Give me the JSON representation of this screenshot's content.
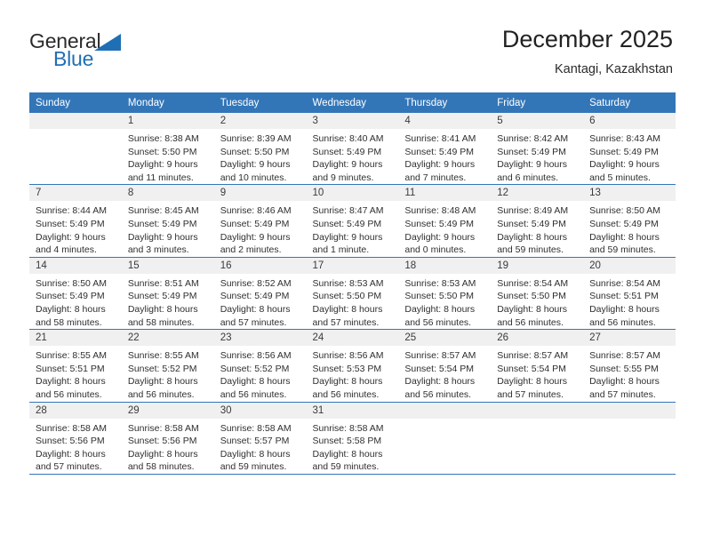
{
  "brand": {
    "name_part1": "General",
    "name_part2": "Blue"
  },
  "header": {
    "title": "December 2025",
    "subtitle": "Kantagi, Kazakhstan"
  },
  "calendar": {
    "weekday_headers": [
      "Sunday",
      "Monday",
      "Tuesday",
      "Wednesday",
      "Thursday",
      "Friday",
      "Saturday"
    ],
    "accent_color": "#3376b8",
    "daynum_band_color": "#f0f0f0",
    "weeks": [
      [
        {
          "day": "",
          "blank": true,
          "sunrise": "",
          "sunset": "",
          "daylight1": "",
          "daylight2": ""
        },
        {
          "day": "1",
          "blank": false,
          "sunrise": "Sunrise: 8:38 AM",
          "sunset": "Sunset: 5:50 PM",
          "daylight1": "Daylight: 9 hours",
          "daylight2": "and 11 minutes."
        },
        {
          "day": "2",
          "blank": false,
          "sunrise": "Sunrise: 8:39 AM",
          "sunset": "Sunset: 5:50 PM",
          "daylight1": "Daylight: 9 hours",
          "daylight2": "and 10 minutes."
        },
        {
          "day": "3",
          "blank": false,
          "sunrise": "Sunrise: 8:40 AM",
          "sunset": "Sunset: 5:49 PM",
          "daylight1": "Daylight: 9 hours",
          "daylight2": "and 9 minutes."
        },
        {
          "day": "4",
          "blank": false,
          "sunrise": "Sunrise: 8:41 AM",
          "sunset": "Sunset: 5:49 PM",
          "daylight1": "Daylight: 9 hours",
          "daylight2": "and 7 minutes."
        },
        {
          "day": "5",
          "blank": false,
          "sunrise": "Sunrise: 8:42 AM",
          "sunset": "Sunset: 5:49 PM",
          "daylight1": "Daylight: 9 hours",
          "daylight2": "and 6 minutes."
        },
        {
          "day": "6",
          "blank": false,
          "sunrise": "Sunrise: 8:43 AM",
          "sunset": "Sunset: 5:49 PM",
          "daylight1": "Daylight: 9 hours",
          "daylight2": "and 5 minutes."
        }
      ],
      [
        {
          "day": "7",
          "blank": false,
          "sunrise": "Sunrise: 8:44 AM",
          "sunset": "Sunset: 5:49 PM",
          "daylight1": "Daylight: 9 hours",
          "daylight2": "and 4 minutes."
        },
        {
          "day": "8",
          "blank": false,
          "sunrise": "Sunrise: 8:45 AM",
          "sunset": "Sunset: 5:49 PM",
          "daylight1": "Daylight: 9 hours",
          "daylight2": "and 3 minutes."
        },
        {
          "day": "9",
          "blank": false,
          "sunrise": "Sunrise: 8:46 AM",
          "sunset": "Sunset: 5:49 PM",
          "daylight1": "Daylight: 9 hours",
          "daylight2": "and 2 minutes."
        },
        {
          "day": "10",
          "blank": false,
          "sunrise": "Sunrise: 8:47 AM",
          "sunset": "Sunset: 5:49 PM",
          "daylight1": "Daylight: 9 hours",
          "daylight2": "and 1 minute."
        },
        {
          "day": "11",
          "blank": false,
          "sunrise": "Sunrise: 8:48 AM",
          "sunset": "Sunset: 5:49 PM",
          "daylight1": "Daylight: 9 hours",
          "daylight2": "and 0 minutes."
        },
        {
          "day": "12",
          "blank": false,
          "sunrise": "Sunrise: 8:49 AM",
          "sunset": "Sunset: 5:49 PM",
          "daylight1": "Daylight: 8 hours",
          "daylight2": "and 59 minutes."
        },
        {
          "day": "13",
          "blank": false,
          "sunrise": "Sunrise: 8:50 AM",
          "sunset": "Sunset: 5:49 PM",
          "daylight1": "Daylight: 8 hours",
          "daylight2": "and 59 minutes."
        }
      ],
      [
        {
          "day": "14",
          "blank": false,
          "sunrise": "Sunrise: 8:50 AM",
          "sunset": "Sunset: 5:49 PM",
          "daylight1": "Daylight: 8 hours",
          "daylight2": "and 58 minutes."
        },
        {
          "day": "15",
          "blank": false,
          "sunrise": "Sunrise: 8:51 AM",
          "sunset": "Sunset: 5:49 PM",
          "daylight1": "Daylight: 8 hours",
          "daylight2": "and 58 minutes."
        },
        {
          "day": "16",
          "blank": false,
          "sunrise": "Sunrise: 8:52 AM",
          "sunset": "Sunset: 5:49 PM",
          "daylight1": "Daylight: 8 hours",
          "daylight2": "and 57 minutes."
        },
        {
          "day": "17",
          "blank": false,
          "sunrise": "Sunrise: 8:53 AM",
          "sunset": "Sunset: 5:50 PM",
          "daylight1": "Daylight: 8 hours",
          "daylight2": "and 57 minutes."
        },
        {
          "day": "18",
          "blank": false,
          "sunrise": "Sunrise: 8:53 AM",
          "sunset": "Sunset: 5:50 PM",
          "daylight1": "Daylight: 8 hours",
          "daylight2": "and 56 minutes."
        },
        {
          "day": "19",
          "blank": false,
          "sunrise": "Sunrise: 8:54 AM",
          "sunset": "Sunset: 5:50 PM",
          "daylight1": "Daylight: 8 hours",
          "daylight2": "and 56 minutes."
        },
        {
          "day": "20",
          "blank": false,
          "sunrise": "Sunrise: 8:54 AM",
          "sunset": "Sunset: 5:51 PM",
          "daylight1": "Daylight: 8 hours",
          "daylight2": "and 56 minutes."
        }
      ],
      [
        {
          "day": "21",
          "blank": false,
          "sunrise": "Sunrise: 8:55 AM",
          "sunset": "Sunset: 5:51 PM",
          "daylight1": "Daylight: 8 hours",
          "daylight2": "and 56 minutes."
        },
        {
          "day": "22",
          "blank": false,
          "sunrise": "Sunrise: 8:55 AM",
          "sunset": "Sunset: 5:52 PM",
          "daylight1": "Daylight: 8 hours",
          "daylight2": "and 56 minutes."
        },
        {
          "day": "23",
          "blank": false,
          "sunrise": "Sunrise: 8:56 AM",
          "sunset": "Sunset: 5:52 PM",
          "daylight1": "Daylight: 8 hours",
          "daylight2": "and 56 minutes."
        },
        {
          "day": "24",
          "blank": false,
          "sunrise": "Sunrise: 8:56 AM",
          "sunset": "Sunset: 5:53 PM",
          "daylight1": "Daylight: 8 hours",
          "daylight2": "and 56 minutes."
        },
        {
          "day": "25",
          "blank": false,
          "sunrise": "Sunrise: 8:57 AM",
          "sunset": "Sunset: 5:54 PM",
          "daylight1": "Daylight: 8 hours",
          "daylight2": "and 56 minutes."
        },
        {
          "day": "26",
          "blank": false,
          "sunrise": "Sunrise: 8:57 AM",
          "sunset": "Sunset: 5:54 PM",
          "daylight1": "Daylight: 8 hours",
          "daylight2": "and 57 minutes."
        },
        {
          "day": "27",
          "blank": false,
          "sunrise": "Sunrise: 8:57 AM",
          "sunset": "Sunset: 5:55 PM",
          "daylight1": "Daylight: 8 hours",
          "daylight2": "and 57 minutes."
        }
      ],
      [
        {
          "day": "28",
          "blank": false,
          "sunrise": "Sunrise: 8:58 AM",
          "sunset": "Sunset: 5:56 PM",
          "daylight1": "Daylight: 8 hours",
          "daylight2": "and 57 minutes."
        },
        {
          "day": "29",
          "blank": false,
          "sunrise": "Sunrise: 8:58 AM",
          "sunset": "Sunset: 5:56 PM",
          "daylight1": "Daylight: 8 hours",
          "daylight2": "and 58 minutes."
        },
        {
          "day": "30",
          "blank": false,
          "sunrise": "Sunrise: 8:58 AM",
          "sunset": "Sunset: 5:57 PM",
          "daylight1": "Daylight: 8 hours",
          "daylight2": "and 59 minutes."
        },
        {
          "day": "31",
          "blank": false,
          "sunrise": "Sunrise: 8:58 AM",
          "sunset": "Sunset: 5:58 PM",
          "daylight1": "Daylight: 8 hours",
          "daylight2": "and 59 minutes."
        },
        {
          "day": "",
          "blank": true,
          "sunrise": "",
          "sunset": "",
          "daylight1": "",
          "daylight2": ""
        },
        {
          "day": "",
          "blank": true,
          "sunrise": "",
          "sunset": "",
          "daylight1": "",
          "daylight2": ""
        },
        {
          "day": "",
          "blank": true,
          "sunrise": "",
          "sunset": "",
          "daylight1": "",
          "daylight2": ""
        }
      ]
    ]
  }
}
